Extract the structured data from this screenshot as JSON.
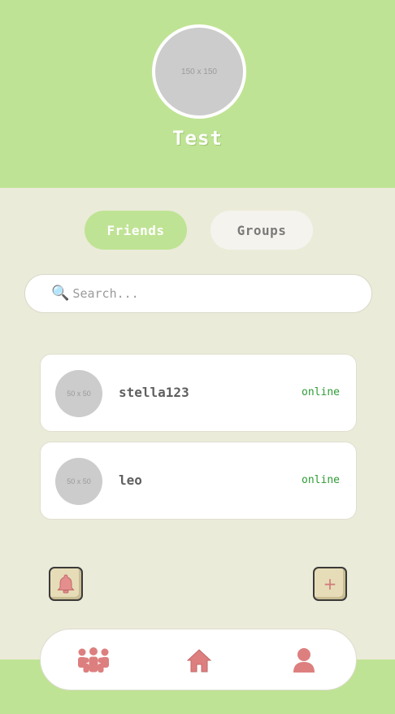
{
  "profile": {
    "avatar_placeholder": "150 x 150",
    "username": "Test"
  },
  "tabs": [
    {
      "label": "Friends",
      "active": true
    },
    {
      "label": "Groups",
      "active": false
    }
  ],
  "search": {
    "icon": "magnifier-icon",
    "placeholder": "Search..."
  },
  "friends": [
    {
      "avatar_placeholder": "50 x 50",
      "name": "stella123",
      "status": "online"
    },
    {
      "avatar_placeholder": "50 x 50",
      "name": "leo",
      "status": "online"
    }
  ],
  "actions": {
    "notifications_icon": "bell-icon",
    "add_symbol": "+"
  },
  "bottom_nav": {
    "items": [
      "friends-icon",
      "home-icon",
      "profile-icon"
    ]
  },
  "colors": {
    "header_green": "#bfe394",
    "background": "#ebebd9",
    "status_online": "#2e9b35",
    "accent_pink": "#dd7f7f"
  }
}
